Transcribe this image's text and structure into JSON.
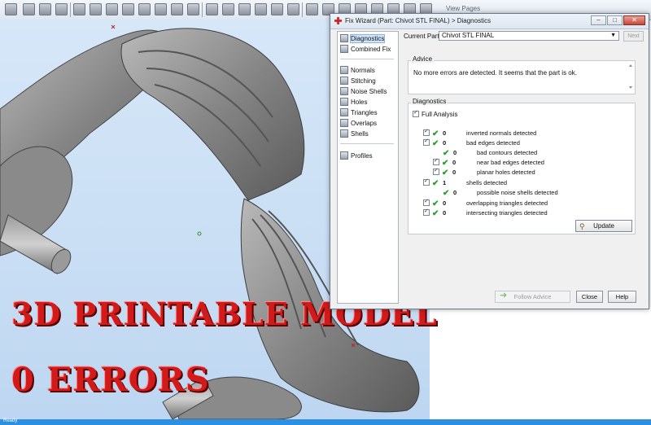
{
  "toolbar": {
    "view_pages": "View Pages"
  },
  "overlay": {
    "line1": "3D PRINTABLE MODEL",
    "line2": "0 ERRORS"
  },
  "status": {
    "text": "Ready"
  },
  "dialog": {
    "title": "Fix Wizard (Part: Chivot STL FINAL) > Diagnostics",
    "nav": {
      "diagnostics": "Diagnostics",
      "combined_fix": "Combined Fix",
      "normals": "Normals",
      "stitching": "Stitching",
      "noise_shells": "Noise Shells",
      "holes": "Holes",
      "triangles": "Triangles",
      "overlaps": "Overlaps",
      "shells": "Shells",
      "profiles": "Profiles"
    },
    "current_part_label": "Current Part:",
    "current_part_value": "Chivot STL FINAL",
    "next_label": "Next",
    "advice_label": "Advice",
    "advice_text": "No more errors are detected. It seems that the part is ok.",
    "diagnostics_label": "Diagnostics",
    "full_analysis_label": "Full Analysis",
    "rows": [
      {
        "count": "0",
        "label": "inverted normals detected"
      },
      {
        "count": "0",
        "label": "bad edges detected"
      },
      {
        "count": "0",
        "label": "bad contours detected"
      },
      {
        "count": "0",
        "label": "near bad edges detected"
      },
      {
        "count": "0",
        "label": "planar holes detected"
      },
      {
        "count": "1",
        "label": "shells detected"
      },
      {
        "count": "0",
        "label": "possible noise shells detected"
      },
      {
        "count": "0",
        "label": "overlapping triangles detected"
      },
      {
        "count": "0",
        "label": "intersecting triangles detected"
      }
    ],
    "update_label": "Update",
    "follow_advice_label": "Follow Advice",
    "close_label": "Close",
    "help_label": "Help"
  },
  "colors": {
    "overlay_text": "#d11a1a",
    "viewport_bg": "#c9def4",
    "status_bar": "#2d8fe0",
    "check": "#2e9b2e"
  }
}
